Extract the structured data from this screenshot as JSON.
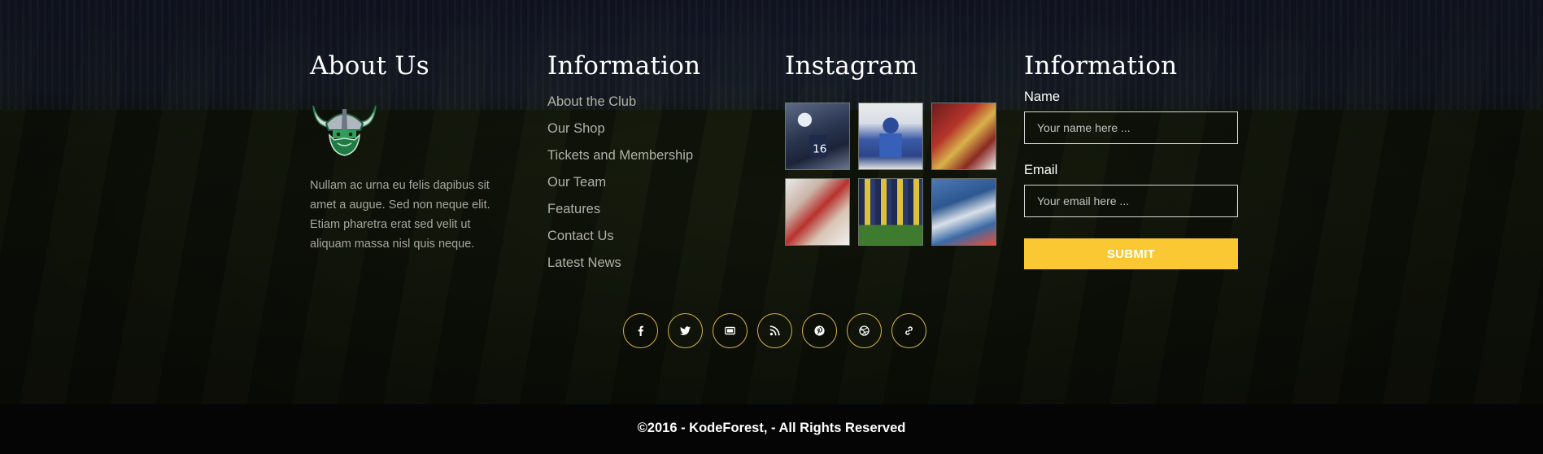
{
  "about": {
    "heading": "About Us",
    "text": "Nullam ac urna eu felis dapibus sit amet a augue. Sed non neque elit. Etiam pharetra erat sed velit ut aliquam massa nisl quis neque."
  },
  "information": {
    "heading": "Information",
    "links": [
      {
        "label": "About the Club"
      },
      {
        "label": "Our Shop"
      },
      {
        "label": "Tickets and Membership"
      },
      {
        "label": "Our Team"
      },
      {
        "label": "Features"
      },
      {
        "label": "Contact Us"
      },
      {
        "label": "Latest News"
      }
    ]
  },
  "instagram": {
    "heading": "Instagram",
    "photos": [
      {
        "icon": "football-photo-icon"
      },
      {
        "icon": "football-photo-icon"
      },
      {
        "icon": "football-photo-icon"
      },
      {
        "icon": "football-photo-icon"
      },
      {
        "icon": "football-photo-icon"
      },
      {
        "icon": "football-photo-icon"
      }
    ]
  },
  "contact_form": {
    "heading": "Information",
    "name_label": "Name",
    "name_placeholder": "Your name here ...",
    "email_label": "Email",
    "email_placeholder": "Your email here ...",
    "submit_label": "SUBMIT"
  },
  "socials": [
    {
      "icon": "facebook-icon"
    },
    {
      "icon": "twitter-icon"
    },
    {
      "icon": "youtube-icon"
    },
    {
      "icon": "rss-icon"
    },
    {
      "icon": "pinterest-icon"
    },
    {
      "icon": "dribbble-icon"
    },
    {
      "icon": "link-icon"
    }
  ],
  "footer": {
    "copyright": "©2016 - KodeForest, - All Rights Reserved"
  },
  "colors": {
    "accent": "#f9c833",
    "social_border": "#d6b04a",
    "footer_bg": "#050505"
  }
}
